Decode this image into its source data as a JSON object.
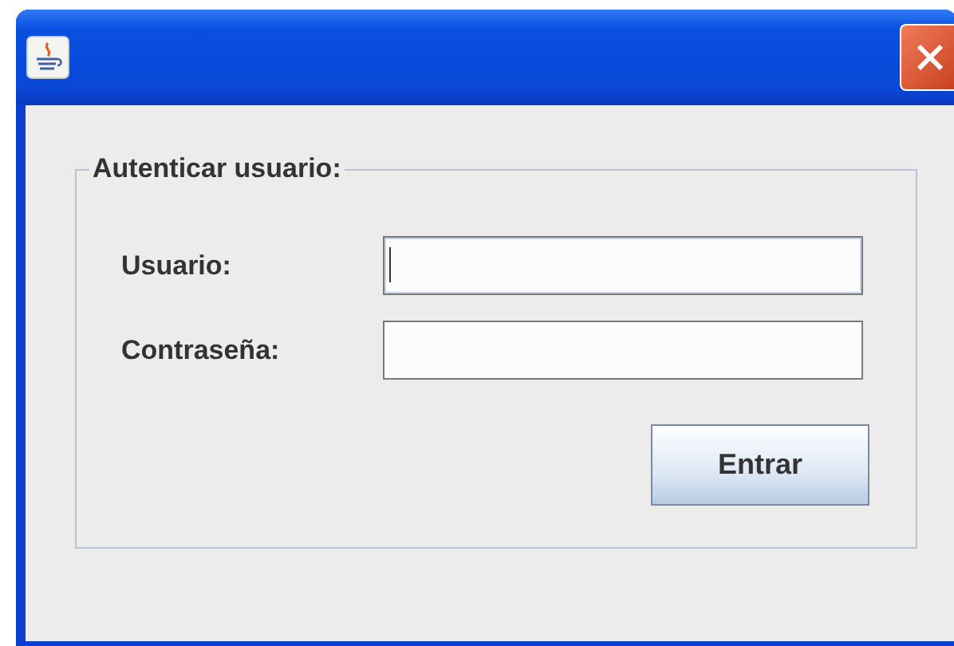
{
  "window": {
    "title_bar": {
      "close_button": true
    }
  },
  "form": {
    "legend": "Autenticar usuario:",
    "fields": [
      {
        "label": "Usuario:",
        "focused": true
      },
      {
        "label": "Contraseña:",
        "focused": false
      }
    ],
    "button": "Entrar"
  }
}
